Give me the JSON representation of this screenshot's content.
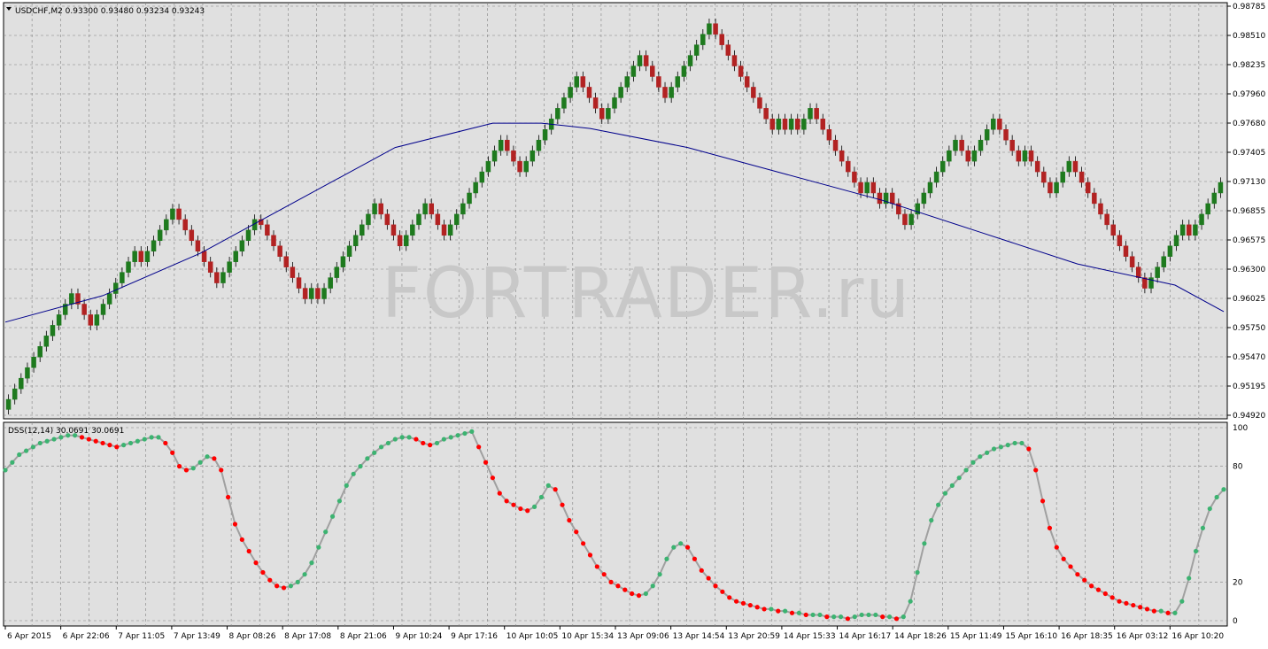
{
  "chart_data": [
    {
      "type": "candlestick",
      "symbol_label": "USDCHF,M2  0.93300 0.93480 0.93234 0.93243",
      "watermark": "FORTRADER.ru",
      "ylim": [
        0.9492,
        0.98785
      ],
      "y_ticks": [
        "0.98785",
        "0.98510",
        "0.98235",
        "0.97960",
        "0.97680",
        "0.97405",
        "0.97130",
        "0.96855",
        "0.96575",
        "0.96300",
        "0.96025",
        "0.95750",
        "0.95470",
        "0.95195",
        "0.94920"
      ],
      "x_ticks": [
        "6 Apr 2015",
        "6 Apr 22:06",
        "7 Apr 11:05",
        "7 Apr 13:49",
        "8 Apr 08:26",
        "8 Apr 17:08",
        "8 Apr 21:06",
        "9 Apr 10:24",
        "9 Apr 17:16",
        "10 Apr 10:05",
        "10 Apr 15:34",
        "13 Apr 09:06",
        "13 Apr 14:54",
        "13 Apr 20:59",
        "14 Apr 15:33",
        "14 Apr 16:17",
        "14 Apr 18:26",
        "15 Apr 11:49",
        "15 Apr 16:10",
        "16 Apr 18:35",
        "16 Apr 03:12",
        "16 Apr 10:20"
      ],
      "ma_line": {
        "color": "#00008b",
        "x_index": [
          0,
          20,
          40,
          60,
          80,
          100,
          110,
          120,
          140,
          160,
          180,
          200,
          220,
          240,
          250
        ],
        "values": [
          0.958,
          0.9605,
          0.9645,
          0.9695,
          0.9745,
          0.9768,
          0.9768,
          0.9763,
          0.9745,
          0.972,
          0.9695,
          0.9665,
          0.9635,
          0.9615,
          0.959
        ]
      },
      "colors": {
        "up": "#1e7a1e",
        "down": "#b22222",
        "grid": "#808080",
        "background": "#e0e0e0"
      },
      "closes": [
        0.9507,
        0.9517,
        0.9527,
        0.9537,
        0.9547,
        0.9557,
        0.9567,
        0.9577,
        0.9587,
        0.9597,
        0.9607,
        0.9597,
        0.9587,
        0.9577,
        0.9587,
        0.9597,
        0.9607,
        0.9617,
        0.9627,
        0.9637,
        0.9647,
        0.9637,
        0.9647,
        0.9657,
        0.9667,
        0.9677,
        0.9687,
        0.9677,
        0.9667,
        0.9657,
        0.9647,
        0.9637,
        0.9627,
        0.9617,
        0.9627,
        0.9637,
        0.9647,
        0.9657,
        0.9667,
        0.9677,
        0.9672,
        0.9662,
        0.9652,
        0.9642,
        0.9632,
        0.9622,
        0.9612,
        0.9602,
        0.9612,
        0.9602,
        0.9612,
        0.9622,
        0.9632,
        0.9642,
        0.9652,
        0.9662,
        0.9672,
        0.9682,
        0.9692,
        0.9682,
        0.9672,
        0.9662,
        0.9652,
        0.9662,
        0.9672,
        0.9682,
        0.9692,
        0.9682,
        0.9672,
        0.9662,
        0.9672,
        0.9682,
        0.9692,
        0.9702,
        0.9712,
        0.9722,
        0.9732,
        0.9742,
        0.9752,
        0.9742,
        0.9732,
        0.9722,
        0.9732,
        0.9742,
        0.9752,
        0.9762,
        0.9772,
        0.9782,
        0.9792,
        0.9802,
        0.9812,
        0.9802,
        0.9792,
        0.9782,
        0.9772,
        0.9782,
        0.9792,
        0.9802,
        0.9812,
        0.9822,
        0.9832,
        0.9822,
        0.9812,
        0.9802,
        0.9792,
        0.9802,
        0.9812,
        0.9822,
        0.9832,
        0.9842,
        0.9852,
        0.9862,
        0.9852,
        0.9842,
        0.9832,
        0.9822,
        0.9812,
        0.9802,
        0.9792,
        0.9782,
        0.9772,
        0.9762,
        0.9772,
        0.9762,
        0.9772,
        0.9762,
        0.9772,
        0.9782,
        0.9772,
        0.9762,
        0.9752,
        0.9742,
        0.9732,
        0.9722,
        0.9712,
        0.9702,
        0.9712,
        0.9702,
        0.9692,
        0.9702,
        0.9692,
        0.9682,
        0.9672,
        0.9682,
        0.9692,
        0.9702,
        0.9712,
        0.9722,
        0.9732,
        0.9742,
        0.9752,
        0.9742,
        0.9732,
        0.9742,
        0.9752,
        0.9762,
        0.9772,
        0.9762,
        0.9752,
        0.9742,
        0.9732,
        0.9742,
        0.9732,
        0.9722,
        0.9712,
        0.9702,
        0.9712,
        0.9722,
        0.9732,
        0.9722,
        0.9712,
        0.9702,
        0.9692,
        0.9682,
        0.9672,
        0.9662,
        0.9652,
        0.9642,
        0.9632,
        0.9622,
        0.9612,
        0.9622,
        0.9632,
        0.9642,
        0.9652,
        0.9662,
        0.9672,
        0.9662,
        0.9672,
        0.9682,
        0.9692,
        0.9702,
        0.9712
      ]
    },
    {
      "type": "line",
      "title": "DSS(12,14) 30.0691 30.0691",
      "ylim": [
        0,
        100
      ],
      "y_ticks": [
        "100",
        "80",
        "20",
        "0"
      ],
      "line_color": "#a0a0a0",
      "up_color": "#3cb371",
      "down_color": "#ff0000",
      "values": [
        78,
        82,
        86,
        88,
        90,
        92,
        93,
        94,
        95,
        96,
        96,
        95,
        94,
        93,
        92,
        91,
        90,
        91,
        92,
        93,
        94,
        95,
        95,
        92,
        87,
        80,
        78,
        79,
        82,
        85,
        84,
        78,
        64,
        50,
        42,
        36,
        30,
        25,
        21,
        18,
        17,
        18,
        20,
        24,
        30,
        38,
        46,
        54,
        62,
        70,
        76,
        80,
        84,
        87,
        90,
        92,
        94,
        95,
        95,
        94,
        92,
        91,
        92,
        94,
        95,
        96,
        97,
        98,
        90,
        82,
        74,
        66,
        62,
        60,
        58,
        57,
        59,
        64,
        70,
        68,
        60,
        52,
        46,
        40,
        34,
        28,
        24,
        20,
        18,
        16,
        14,
        13,
        14,
        18,
        24,
        32,
        38,
        40,
        38,
        32,
        26,
        22,
        18,
        15,
        12,
        10,
        9,
        8,
        7,
        6,
        6,
        5,
        5,
        4,
        4,
        3,
        3,
        3,
        2,
        2,
        2,
        1,
        2,
        3,
        3,
        3,
        2,
        2,
        1,
        2,
        10,
        25,
        40,
        52,
        60,
        66,
        70,
        74,
        78,
        82,
        85,
        87,
        89,
        90,
        91,
        92,
        92,
        89,
        78,
        62,
        48,
        38,
        32,
        28,
        24,
        21,
        18,
        16,
        14,
        12,
        10,
        9,
        8,
        7,
        6,
        5,
        5,
        4,
        4,
        10,
        22,
        36,
        48,
        58,
        64,
        68
      ]
    }
  ]
}
